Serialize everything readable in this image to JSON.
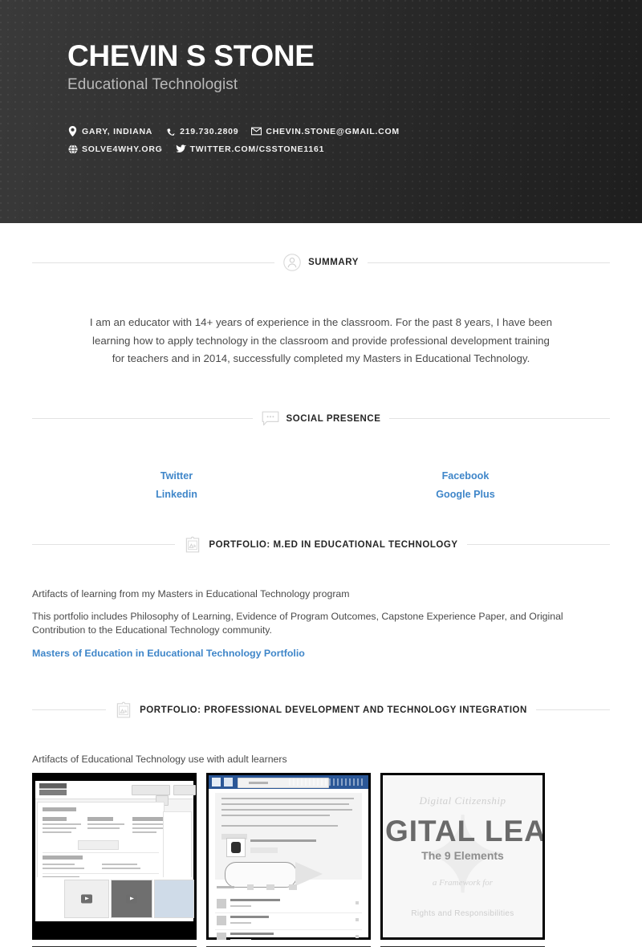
{
  "header": {
    "name": "CHEVIN S STONE",
    "job_title": "Educational Technologist",
    "contacts_line1": [
      {
        "icon": "location-pin-icon",
        "text": "GARY, INDIANA"
      },
      {
        "icon": "phone-icon",
        "text": "219.730.2809"
      },
      {
        "icon": "envelope-icon",
        "text": "CHEVIN.STONE@GMAIL.COM"
      }
    ],
    "contacts_line2": [
      {
        "icon": "globe-icon",
        "text": "SOLVE4WHY.ORG"
      },
      {
        "icon": "twitter-bird-icon",
        "text": "TWITTER.COM/CSSTONE1161"
      }
    ]
  },
  "sections": {
    "summary": {
      "title": "SUMMARY",
      "icon": "person-circle-icon",
      "text": "I am an educator with 14+ years of experience in the classroom.  For the past 8 years, I have been learning how to apply technology in the classroom and provide professional development training for teachers and in 2014, successfully completed my Masters in Educational Technology."
    },
    "social": {
      "title": "SOCIAL PRESENCE",
      "icon": "speech-bubble-icon",
      "left_links": [
        "Twitter",
        "Linkedin"
      ],
      "right_links": [
        "Facebook",
        "Google Plus"
      ]
    },
    "portfolio_med": {
      "title": "PORTFOLIO: M.ED IN EDUCATIONAL TECHNOLOGY",
      "icon": "framed-picture-icon",
      "line1": "Artifacts of learning from my Masters in Educational Technology program",
      "line2": "This portfolio includes Philosophy of Learning, Evidence of Program Outcomes, Capstone Experience Paper, and Original Contribution to the Educational Technology community.",
      "link": "Masters of Education in Educational Technology Portfolio"
    },
    "portfolio_pd": {
      "title": "PORTFOLIO: PROFESSIONAL DEVELOPMENT AND TECHNOLOGY INTEGRATION",
      "icon": "framed-picture-icon",
      "caption": "Artifacts of Educational Technology use with adult learners",
      "thumbnails": [
        {
          "name": "lms-course-page-screenshot",
          "alt": "Learning management system course page screenshot with assessments, digital storytelling and presentation tools sections"
        },
        {
          "name": "remind-messaging-screenshot",
          "alt": "Browser screenshot of a class messaging thread with homework assignment attachment"
        },
        {
          "name": "digital-citizenship-poster",
          "alt": "Digital Citizenship - The 9 Elements poster"
        }
      ],
      "poster": {
        "superline": "Digital Citizenship",
        "main": "DIGITAL LEADERSHIP",
        "sub": "The 9 Elements",
        "sub2": "a Framework for",
        "foot": "Rights and Responsibilities"
      }
    }
  },
  "colors": {
    "header_dark": "#2c2c2c",
    "link_blue": "#3f86c9",
    "body_text": "#4a4a4a",
    "rule": "#e2e2e2"
  }
}
